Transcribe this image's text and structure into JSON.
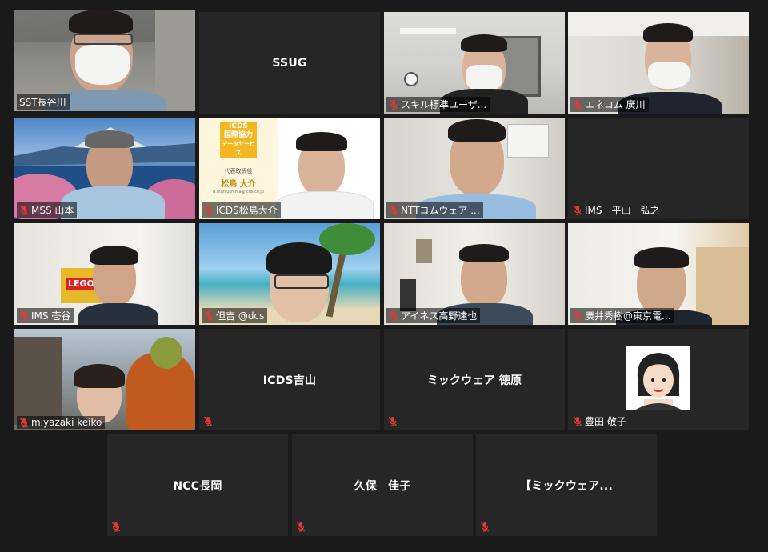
{
  "participants": [
    {
      "id": "sst",
      "name": "SST長谷川",
      "muted": false,
      "video": true,
      "active": true
    },
    {
      "id": "ssug",
      "name": "SSUG",
      "muted": false,
      "video": false
    },
    {
      "id": "skill",
      "name": "スキル標準ユーザ...",
      "muted": true,
      "video": true
    },
    {
      "id": "enecom",
      "name": "エネコム 廣川",
      "muted": true,
      "video": true
    },
    {
      "id": "mss",
      "name": "MSS 山本",
      "muted": true,
      "video": true
    },
    {
      "id": "icds-matsushima",
      "name": "ICDS松島大介",
      "muted": true,
      "video": true
    },
    {
      "id": "ntt",
      "name": "NTTコムウェア  ...",
      "muted": true,
      "video": true
    },
    {
      "id": "ims-hirayama",
      "name": "IMS　平山　弘之",
      "muted": true,
      "video": false
    },
    {
      "id": "ims-ichitani",
      "name": "IMS 壱谷",
      "muted": true,
      "video": true
    },
    {
      "id": "tadayoshi",
      "name": "但吉 @dcs",
      "muted": true,
      "video": true
    },
    {
      "id": "ainess",
      "name": "アイネス高野達也",
      "muted": true,
      "video": true
    },
    {
      "id": "hiroi",
      "name": "廣井秀樹@東京電...",
      "muted": true,
      "video": true
    },
    {
      "id": "miyazaki",
      "name": "miyazaki keiko",
      "muted": true,
      "video": true
    },
    {
      "id": "icds-yoshiyama",
      "name": "ICDS吉山",
      "muted": true,
      "video": false
    },
    {
      "id": "mic-tokuhara",
      "name": "ミックウェア 徳原",
      "muted": true,
      "video": false
    },
    {
      "id": "toyoda",
      "name": "豊田 敬子",
      "muted": true,
      "video": false,
      "avatar": true
    },
    {
      "id": "ncc",
      "name": "NCC長岡",
      "muted": true,
      "video": false
    },
    {
      "id": "kubo",
      "name": "久保　佳子",
      "muted": true,
      "video": false
    },
    {
      "id": "mic-2",
      "name": "【ミックウェア...",
      "muted": true,
      "video": false
    }
  ],
  "card": {
    "logo_top": "ICDS",
    "logo_main": "国際協力",
    "logo_sub": "データサービス",
    "title": "代表取締役",
    "name": "松島 大介",
    "email": "d.matsushima@icds.co.jp"
  },
  "tshirt_text": "LEGO",
  "colors": {
    "background": "#1a1a1a",
    "tile": "#262626",
    "active_border": "#c5e04a",
    "mute_red": "#e53935"
  }
}
